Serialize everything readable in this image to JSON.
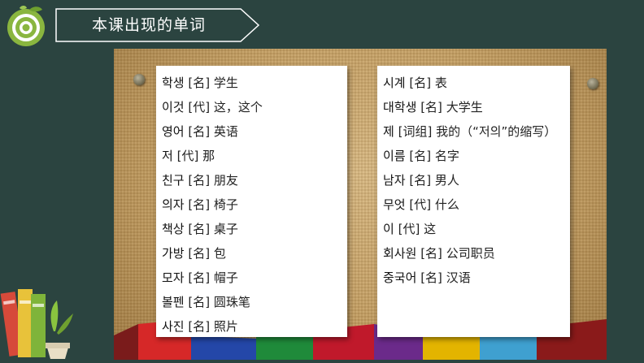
{
  "header": {
    "title": "本课出现的单词",
    "logo_icon": "target-leaf-icon"
  },
  "colors": {
    "background": "#2b4440",
    "logo_green": "#8ab63f",
    "panel": "#ffffff"
  },
  "vocab_left": [
    {
      "ko": "학생",
      "pos": "[名]",
      "zh": "学生"
    },
    {
      "ko": "이것",
      "pos": "[代]",
      "zh": "这，这个"
    },
    {
      "ko": "영어",
      "pos": "[名]",
      "zh": "英语"
    },
    {
      "ko": "저",
      "pos": "[代]",
      "zh": "那"
    },
    {
      "ko": "친구",
      "pos": "[名]",
      "zh": "朋友"
    },
    {
      "ko": "의자",
      "pos": "[名]",
      "zh": "椅子"
    },
    {
      "ko": "책상",
      "pos": "[名]",
      "zh": "桌子"
    },
    {
      "ko": "가방",
      "pos": "[名]",
      "zh": "包"
    },
    {
      "ko": "모자",
      "pos": "[名]",
      "zh": "帽子"
    },
    {
      "ko": "볼펜",
      "pos": "[名]",
      "zh": "圆珠笔"
    },
    {
      "ko": "사진",
      "pos": "[名]",
      "zh": "照片"
    }
  ],
  "vocab_right": [
    {
      "ko": "시계",
      "pos": "[名]",
      "zh": "表"
    },
    {
      "ko": "대학생",
      "pos": "[名]",
      "zh": "大学生"
    },
    {
      "ko": "제",
      "pos": "[词组]",
      "zh": "我的（“저의”的缩写）"
    },
    {
      "ko": "이름",
      "pos": "[名]",
      "zh": "名字"
    },
    {
      "ko": "남자",
      "pos": "[名]",
      "zh": "男人"
    },
    {
      "ko": "무엇",
      "pos": "[代]",
      "zh": "什么"
    },
    {
      "ko": "이",
      "pos": "[代]",
      "zh": "这"
    },
    {
      "ko": "회사원",
      "pos": "[名]",
      "zh": "公司职员"
    },
    {
      "ko": "중국어",
      "pos": "[名]",
      "zh": "汉语"
    }
  ],
  "decor": {
    "corner_icon": "books-plant-icon",
    "pin_icon": "thumbtack-icon"
  }
}
